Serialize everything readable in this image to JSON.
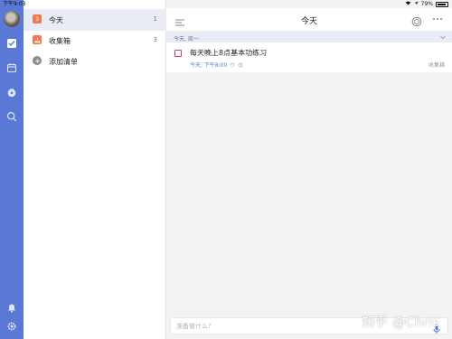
{
  "status_bar": {
    "time": "下午9:03",
    "battery": "79%"
  },
  "colors": {
    "accent": "#5a78d6",
    "rail": "#5a78d6",
    "checkbox": "#d23c6b",
    "inbox_icon": "#f07a4f",
    "today_icon": "#f07a4f"
  },
  "rail": {
    "icons": [
      "avatar",
      "checkbox-icon",
      "calendar-icon",
      "pomodoro-icon",
      "search-icon",
      "bell-icon",
      "settings-icon"
    ]
  },
  "lists": [
    {
      "icon": "calendar-day-icon",
      "icon_text": "3",
      "label": "今天",
      "count": "1"
    },
    {
      "icon": "inbox-icon",
      "label": "收集箱",
      "count": "3"
    },
    {
      "icon": "plus-circle-icon",
      "label": "添加清单",
      "count": ""
    }
  ],
  "header": {
    "title": "今天"
  },
  "section": {
    "label": "今天, 周一"
  },
  "tasks": [
    {
      "title": "每天晚上8点基本功练习",
      "time": "今天, 下午8:00",
      "list": "收集箱"
    }
  ],
  "add_task": {
    "placeholder": "准备做什么?"
  },
  "watermark": "知乎 @Chris"
}
